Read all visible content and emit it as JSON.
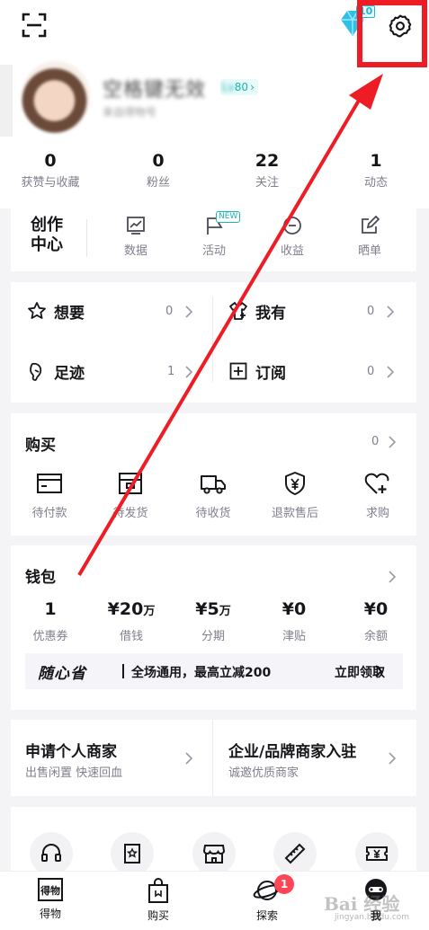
{
  "profile": {
    "nickname": "空格键无效",
    "level_prefix": "Lv",
    "level_value": "80",
    "subline": "来自得物号",
    "vip_level": "10"
  },
  "stats": [
    {
      "value": "0",
      "label": "获赞与收藏"
    },
    {
      "value": "0",
      "label": "粉丝"
    },
    {
      "value": "22",
      "label": "关注"
    },
    {
      "value": "1",
      "label": "动态"
    }
  ],
  "creation_center": {
    "title_line1": "创作",
    "title_line2": "中心",
    "new_tag": "NEW",
    "items": [
      {
        "label": "数据",
        "icon": "chart-icon"
      },
      {
        "label": "活动",
        "icon": "flag-icon"
      },
      {
        "label": "收益",
        "icon": "coin-icon"
      },
      {
        "label": "晒单",
        "icon": "edit-icon"
      }
    ]
  },
  "collections": [
    {
      "label": "想要",
      "count": "0",
      "icon": "star-icon"
    },
    {
      "label": "我有",
      "count": "0",
      "icon": "shirt-icon"
    },
    {
      "label": "足迹",
      "count": "1",
      "icon": "footprint-icon"
    },
    {
      "label": "订阅",
      "count": "0",
      "icon": "plus-square-icon"
    }
  ],
  "purchases": {
    "title": "购买",
    "count": "0",
    "items": [
      {
        "label": "待付款",
        "icon": "wallet-icon"
      },
      {
        "label": "待发货",
        "icon": "box-icon"
      },
      {
        "label": "待收货",
        "icon": "truck-icon"
      },
      {
        "label": "退款售后",
        "icon": "shield-yen-icon"
      },
      {
        "label": "求购",
        "icon": "heart-plus-icon"
      }
    ]
  },
  "wallet": {
    "title": "钱包",
    "items": [
      {
        "value": "1",
        "unit": "",
        "label": "优惠券"
      },
      {
        "value": "¥20",
        "unit": "万",
        "label": "借钱"
      },
      {
        "value": "¥5",
        "unit": "万",
        "label": "分期"
      },
      {
        "value": "¥0",
        "unit": "",
        "label": "津贴"
      },
      {
        "value": "¥0",
        "unit": "",
        "label": "余额"
      }
    ],
    "promo": {
      "logo": "随心省",
      "text": "全场通用，最高立减200",
      "cta": "立即领取"
    }
  },
  "merchant": [
    {
      "title": "申请个人商家",
      "subtitle": "出售闲置 快速回血"
    },
    {
      "title": "企业/品牌商家入驻",
      "subtitle": "诚邀优质商家"
    }
  ],
  "services": [
    "headset-icon",
    "photo-book-icon",
    "store-icon",
    "ruler-icon",
    "ticket-yen-icon"
  ],
  "tabbar": {
    "items": [
      {
        "label": "得物",
        "icon": "dewu-logo-icon"
      },
      {
        "label": "购买",
        "icon": "bag-icon"
      },
      {
        "label": "探索",
        "icon": "planet-icon"
      },
      {
        "label": "我",
        "icon": "profile-avatar-icon"
      }
    ],
    "explore_badge": "1"
  },
  "watermark": {
    "text": "Bai 经验",
    "sub": "jingyan.baidu.com"
  },
  "colors": {
    "annotation": "#ee1c25",
    "accent": "#1fb5b1",
    "badge": "#ff4657"
  }
}
